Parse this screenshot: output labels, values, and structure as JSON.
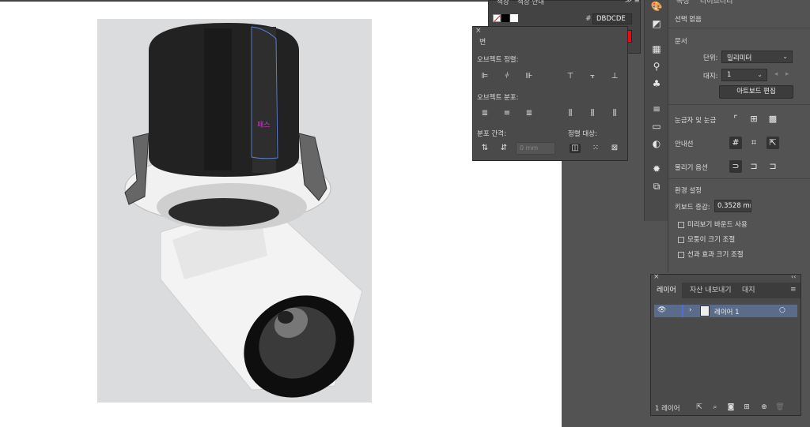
{
  "colors": {
    "artboard": "#dbdcde",
    "accent": "#5a6c8a",
    "path_label": "#c040c0"
  },
  "artwork": {
    "path_label": "패스"
  },
  "color_panel": {
    "tab_color": "색상",
    "tab_guide": "색상 안내",
    "hex_prefix": "#",
    "hex_value": "DBDCDE"
  },
  "align_panel": {
    "tab_partial": "변",
    "align_objects": "오브젝트 정렬:",
    "distribute_objects": "오브젝트 분포:",
    "distribute_spacing": "분포 간격:",
    "align_to": "정렬 대상:",
    "spacing_placeholder": "0 mm"
  },
  "properties": {
    "tab_properties": "속성",
    "tab_libraries": "라이브러리",
    "no_selection": "선택 없음",
    "document_section": "문서",
    "units_label": "단위:",
    "units_value": "밀리미터",
    "artboard_label": "대지:",
    "artboard_value": "1",
    "edit_artboards_button": "아트보드 편집",
    "rulers_grids": "눈금자 및 눈금",
    "guides": "안내선",
    "snap_options": "물리기 옵션",
    "preferences": "환경 설정",
    "keyboard_increment_label": "키보드 증감:",
    "keyboard_increment_value": "0.3528 mm",
    "checkbox_preview_bounds": "미리보기 바운드 사용",
    "checkbox_scale_corners": "모퉁이 크기 조절",
    "checkbox_scale_strokes": "선과 효과 크기 조절"
  },
  "layers_panel": {
    "tabs": [
      "레이어",
      "자산 내보내기",
      "대지"
    ],
    "layer_name": "레이어 1",
    "layer_count": "1 레이어"
  },
  "icons": [
    "paint-icon",
    "gradient-icon",
    "grid-icon",
    "usb-icon",
    "club-icon",
    "lines-icon",
    "rect-icon",
    "circle-icon",
    "sun-icon",
    "layers-icon"
  ]
}
